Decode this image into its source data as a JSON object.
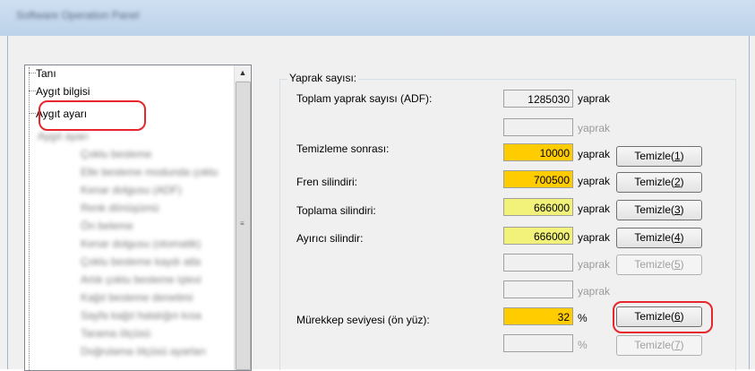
{
  "window": {
    "title": "Software Operation Panel"
  },
  "tree": {
    "items": [
      {
        "label": "Tanı"
      },
      {
        "label": "Aygıt bilgisi"
      },
      {
        "label": "Aygıt ayarı"
      },
      {
        "label": "Aygıt ayarı"
      },
      {
        "label": "Çoklu besleme"
      },
      {
        "label": "Elle besleme modunda çoklu"
      },
      {
        "label": "Kenar dolgusu (ADF)"
      },
      {
        "label": "Renk dönüşümü"
      },
      {
        "label": "Ön beleme"
      },
      {
        "label": "Kenar dolgusu (otomatik)"
      },
      {
        "label": "Çoklu besleme kaydı atla"
      },
      {
        "label": "Artık çoklu besleme işlevi"
      },
      {
        "label": "Kağıt besleme denetimi"
      },
      {
        "label": "Sayfa kağıt hatalığın kısa"
      },
      {
        "label": "Tarama ölçüsü"
      },
      {
        "label": "Doğrulama ölçüsü ayarları"
      }
    ],
    "scroll_up_glyph": "▲",
    "grip_glyph": "≡"
  },
  "group": {
    "title": "Yaprak sayısı:",
    "rows": [
      {
        "label": "Toplam yaprak sayısı (ADF):",
        "value": "1285030",
        "unit": "yaprak",
        "button": ""
      },
      {
        "label": "",
        "value": "",
        "unit": "yaprak",
        "button": ""
      },
      {
        "label": "Temizleme sonrası:",
        "value": "10000",
        "unit": "yaprak",
        "button": "Temizle(1)",
        "btn_text": "Temizle(",
        "btn_key": "1",
        "btn_end": ")"
      },
      {
        "label": "Fren silindiri:",
        "value": "700500",
        "unit": "yaprak",
        "button": "Temizle(2)",
        "btn_text": "Temizle(",
        "btn_key": "2",
        "btn_end": ")"
      },
      {
        "label": "Toplama silindiri:",
        "value": "666000",
        "unit": "yaprak",
        "button": "Temizle(3)",
        "btn_text": "Temizle(",
        "btn_key": "3",
        "btn_end": ")"
      },
      {
        "label": "Ayırıcı silindir:",
        "value": "666000",
        "unit": "yaprak",
        "button": "Temizle(4)",
        "btn_text": "Temizle(",
        "btn_key": "4",
        "btn_end": ")"
      },
      {
        "label": "",
        "value": "",
        "unit": "yaprak",
        "button": "Temizle(5)",
        "btn_text": "Temizle(",
        "btn_key": "5",
        "btn_end": ")"
      },
      {
        "label": "",
        "value": "",
        "unit": "yaprak",
        "button": ""
      },
      {
        "label": "Mürekkep seviyesi (ön yüz):",
        "value": "32",
        "unit": "%",
        "button": "Temizle(6)",
        "btn_text": "Temizle(",
        "btn_key": "6",
        "btn_end": ")"
      },
      {
        "label": "",
        "value": "",
        "unit": "%",
        "button": "Temizle(7)",
        "btn_text": "Temizle(",
        "btn_key": "7",
        "btn_end": ")"
      }
    ]
  },
  "colors": {
    "highlight": "#e8262d",
    "counter_orange": "#ffcc00",
    "counter_yellow": "#f2f27a"
  }
}
